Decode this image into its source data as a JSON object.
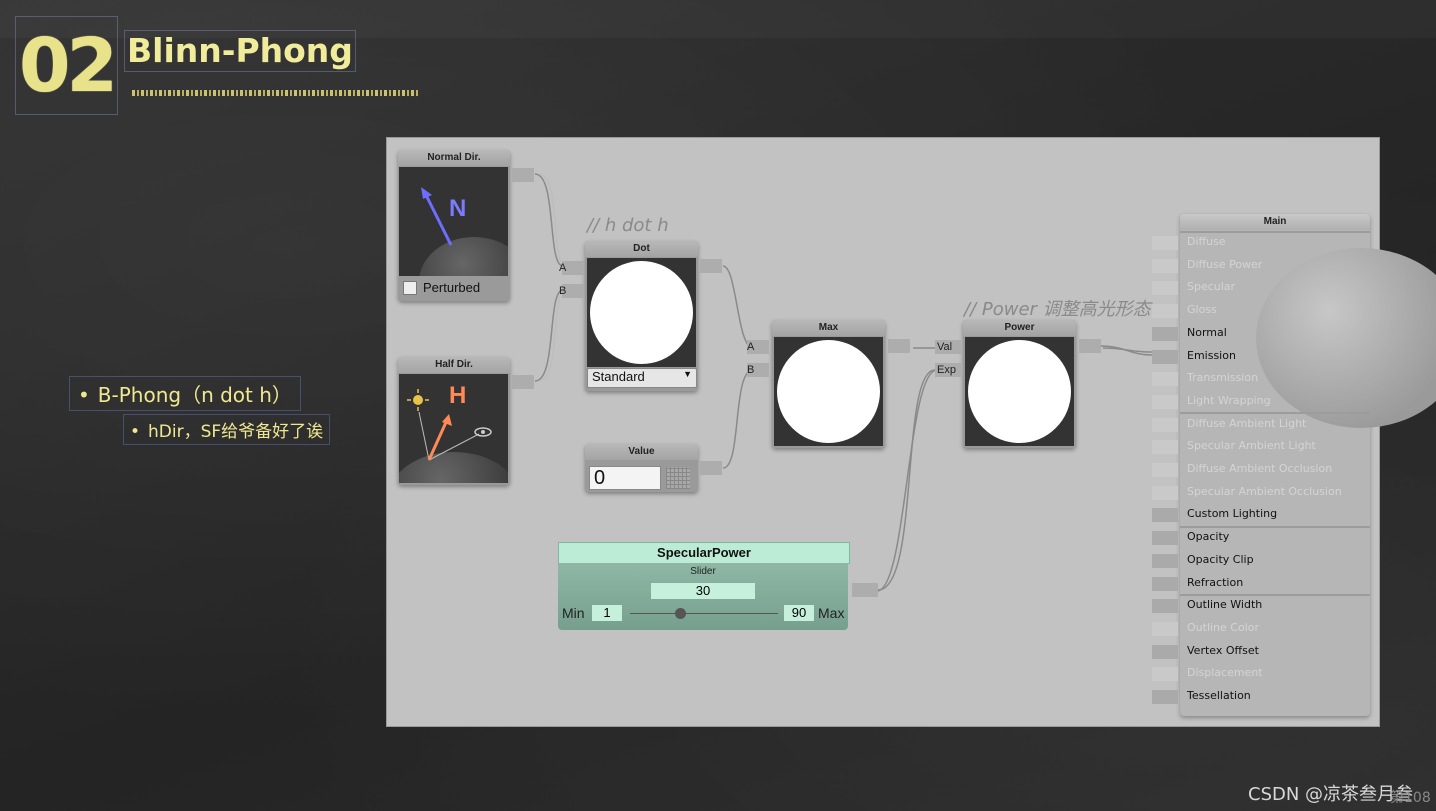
{
  "slide": {
    "number": "02",
    "title": "Blinn-Phong",
    "bullets": [
      "B-Phong（n dot h）",
      "hDir，SF给爷备好了诶"
    ],
    "footer": "CSDN @凉茶叁月叁",
    "page": "第108"
  },
  "canvas": {
    "comment_dot": "// h dot h",
    "comment_power": "//  Power 调整高光形态",
    "nodes": {
      "normal_dir": {
        "title": "Normal Dir.",
        "letter": "N",
        "checkbox_label": "Perturbed"
      },
      "half_dir": {
        "title": "Half Dir.",
        "letter": "H"
      },
      "dot": {
        "title": "Dot",
        "port_a": "A",
        "port_b": "B",
        "mode": "Standard"
      },
      "value": {
        "title": "Value",
        "value": "0"
      },
      "max": {
        "title": "Max",
        "port_a": "A",
        "port_b": "B"
      },
      "power": {
        "title": "Power",
        "port_val": "Val",
        "port_exp": "Exp"
      },
      "specular_power": {
        "title": "SpecularPower",
        "type": "Slider",
        "value": "30",
        "min_label": "Min",
        "min": "1",
        "max": "90",
        "max_label": "Max"
      }
    },
    "main": {
      "title": "Main",
      "inputs": [
        {
          "label": "Diffuse",
          "active": false
        },
        {
          "label": "Diffuse Power",
          "active": false
        },
        {
          "label": "Specular",
          "active": false
        },
        {
          "label": "Gloss",
          "active": false
        },
        {
          "label": "Normal",
          "active": true
        },
        {
          "label": "Emission",
          "active": true
        },
        {
          "label": "Transmission",
          "active": false
        },
        {
          "label": "Light Wrapping",
          "active": false
        },
        {
          "label": "Diffuse Ambient Light",
          "active": false
        },
        {
          "label": "Specular Ambient Light",
          "active": false
        },
        {
          "label": "Diffuse Ambient Occlusion",
          "active": false
        },
        {
          "label": "Specular Ambient Occlusion",
          "active": false
        },
        {
          "label": "Custom Lighting",
          "active": true
        },
        {
          "label": "Opacity",
          "active": true
        },
        {
          "label": "Opacity Clip",
          "active": true
        },
        {
          "label": "Refraction",
          "active": true
        },
        {
          "label": "Outline Width",
          "active": true
        },
        {
          "label": "Outline Color",
          "active": false
        },
        {
          "label": "Vertex Offset",
          "active": true
        },
        {
          "label": "Displacement",
          "active": false
        },
        {
          "label": "Tessellation",
          "active": true
        }
      ]
    }
  },
  "colors": {
    "title": "#f1ec9a",
    "slider_head": "#bdecd6",
    "normal_letter": "#7b7bff",
    "half_letter": "#ff8a55"
  }
}
